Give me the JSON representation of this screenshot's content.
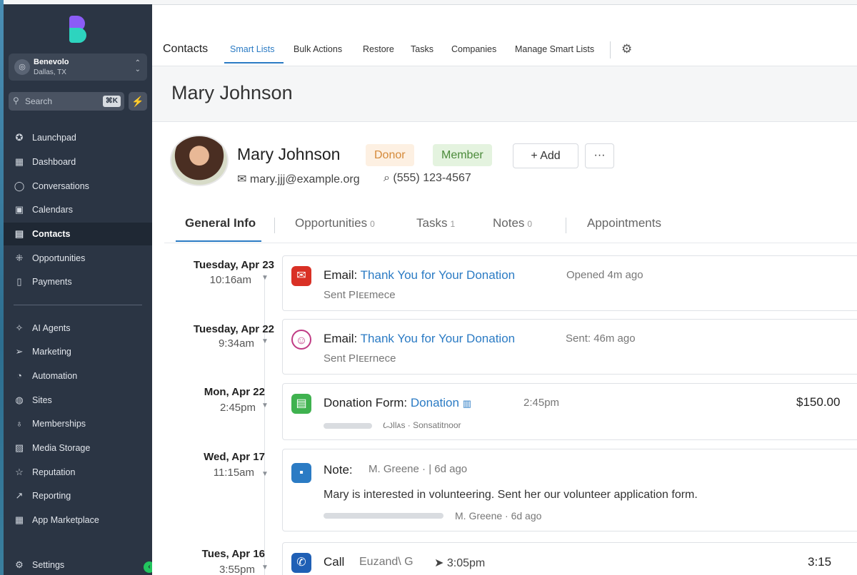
{
  "sidebar": {
    "account": {
      "name": "Benevolo",
      "location": "Dallas, TX"
    },
    "search": {
      "placeholder": "Search",
      "shortcut": "⌘K"
    },
    "items": [
      {
        "label": "Launchpad",
        "icon": "rocket-icon"
      },
      {
        "label": "Dashboard",
        "icon": "grid-icon"
      },
      {
        "label": "Conversations",
        "icon": "chat-icon"
      },
      {
        "label": "Calendars",
        "icon": "calendar-icon"
      },
      {
        "label": "Contacts",
        "icon": "contacts-icon",
        "active": true
      },
      {
        "label": "Opportunities",
        "icon": "opportunities-icon"
      },
      {
        "label": "Payments",
        "icon": "payments-icon"
      },
      {
        "label": "AI Agents",
        "icon": "sparkle-icon"
      },
      {
        "label": "Marketing",
        "icon": "send-icon"
      },
      {
        "label": "Automation",
        "icon": "automation-icon"
      },
      {
        "label": "Sites",
        "icon": "globe-icon"
      },
      {
        "label": "Memberships",
        "icon": "award-icon"
      },
      {
        "label": "Media Storage",
        "icon": "image-icon"
      },
      {
        "label": "Reputation",
        "icon": "star-icon"
      },
      {
        "label": "Reporting",
        "icon": "trend-icon"
      },
      {
        "label": "App Marketplace",
        "icon": "apps-icon"
      },
      {
        "label": "Settings",
        "icon": "gear-icon"
      }
    ]
  },
  "topbar": {
    "title": "Contacts",
    "tabs": [
      "Smart Lists",
      "Bulk Actions",
      "Restore",
      "Tasks",
      "Companies",
      "Manage Smart Lists"
    ]
  },
  "page_title": "Mary Johnson",
  "contact": {
    "name": "Mary Johnson",
    "badges": [
      "Donor",
      "Member"
    ],
    "add_label": "+ Add",
    "more_label": "···",
    "email": "mary.jjj@example.org",
    "phone": "(555) 123-4567"
  },
  "detail_tabs": [
    {
      "label": "General Info",
      "count": ""
    },
    {
      "label": "Opportunities",
      "count": "0"
    },
    {
      "label": "Tasks",
      "count": "1"
    },
    {
      "label": "Notes",
      "count": "0"
    },
    {
      "label": "Appointments",
      "count": ""
    }
  ],
  "timeline": [
    {
      "date": "Tuesday, Apr 23",
      "time": "10:16am",
      "kind": "Email:",
      "link": "Thank You for Your Donation",
      "meta": "Opened 4m ago",
      "sub": "Sent PIᴇᴇmece"
    },
    {
      "date": "Tuesday, Apr 22",
      "time": "9:34am",
      "kind": "Email:",
      "link": "Thank You for Your Donation",
      "meta": "Sent: 46m ago",
      "sub": "Sent PIᴇᴇrnece"
    },
    {
      "date": "Mon, Apr 22",
      "time": "2:45pm",
      "kind": "Donation Form:",
      "link": "Donation",
      "meta": "2:45pm",
      "sub": "Ꙍllᴀs · Sonsatitnoor",
      "amount": "$150.00"
    },
    {
      "date": "Wed, Apr 17",
      "time": "11:15am",
      "kind": "Note:",
      "link": "",
      "meta": "M. Greene  · | 6d ago",
      "sub": "Mary is interested in volunteering. Sent her our volunteer application form.",
      "footer": "M. Greene · 6d ago"
    },
    {
      "date": "Tues, Apr 16",
      "time": "3:55pm",
      "kind": "Call",
      "link": "",
      "meta": "Euzand\\ G",
      "time2": "3:05pm",
      "amount": "3:15"
    }
  ]
}
